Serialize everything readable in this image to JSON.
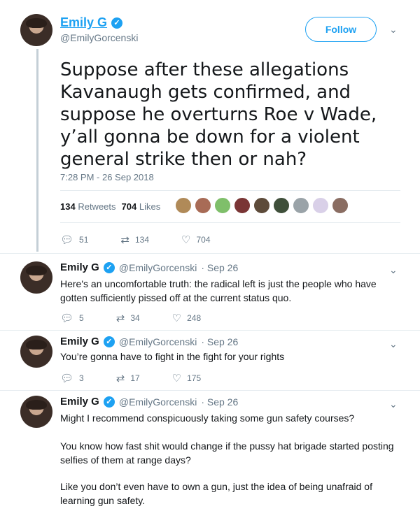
{
  "main_tweet": {
    "display_name": "Emily G",
    "handle": "@EmilyGorcenski",
    "follow_label": "Follow",
    "text": "Suppose after these allegations Kavanaugh gets confirmed, and suppose he overturns Roe v Wade, y’all gonna be down for a violent general strike then or nah?",
    "timestamp": "7:28 PM - 26 Sep 2018",
    "retweets_count": "134",
    "retweets_label": "Retweets",
    "likes_count": "704",
    "likes_label": "Likes",
    "actions": {
      "replies": "51",
      "retweets": "134",
      "likes": "704"
    }
  },
  "replies": [
    {
      "display_name": "Emily G",
      "handle": "@EmilyGorcenski",
      "date": "· Sep 26",
      "text": "Here's an uncomfortable truth: the radical left is just the people who have gotten sufficiently pissed off at the current status quo.",
      "actions": {
        "replies": "5",
        "retweets": "34",
        "likes": "248"
      }
    },
    {
      "display_name": "Emily G",
      "handle": "@EmilyGorcenski",
      "date": "· Sep 26",
      "text": "You’re gonna have to fight in the fight for your rights",
      "actions": {
        "replies": "3",
        "retweets": "17",
        "likes": "175"
      }
    },
    {
      "display_name": "Emily G",
      "handle": "@EmilyGorcenski",
      "date": "· Sep 26",
      "paragraphs": [
        "Might I recommend conspicuously taking some gun safety courses?",
        "You know how fast shit would change if the pussy hat brigade started posting selfies of them at range days?",
        "Like you don’t even have to own a gun, just the idea of being unafraid of learning gun safety."
      ]
    }
  ],
  "icons": {
    "verified": "verified-check-icon",
    "reply": "reply-icon",
    "retweet": "retweet-icon",
    "like": "heart-icon",
    "more": "chevron-down-icon"
  },
  "colors": {
    "accent": "#1da1f2",
    "muted": "#657786",
    "divider": "#e6ecf0"
  }
}
